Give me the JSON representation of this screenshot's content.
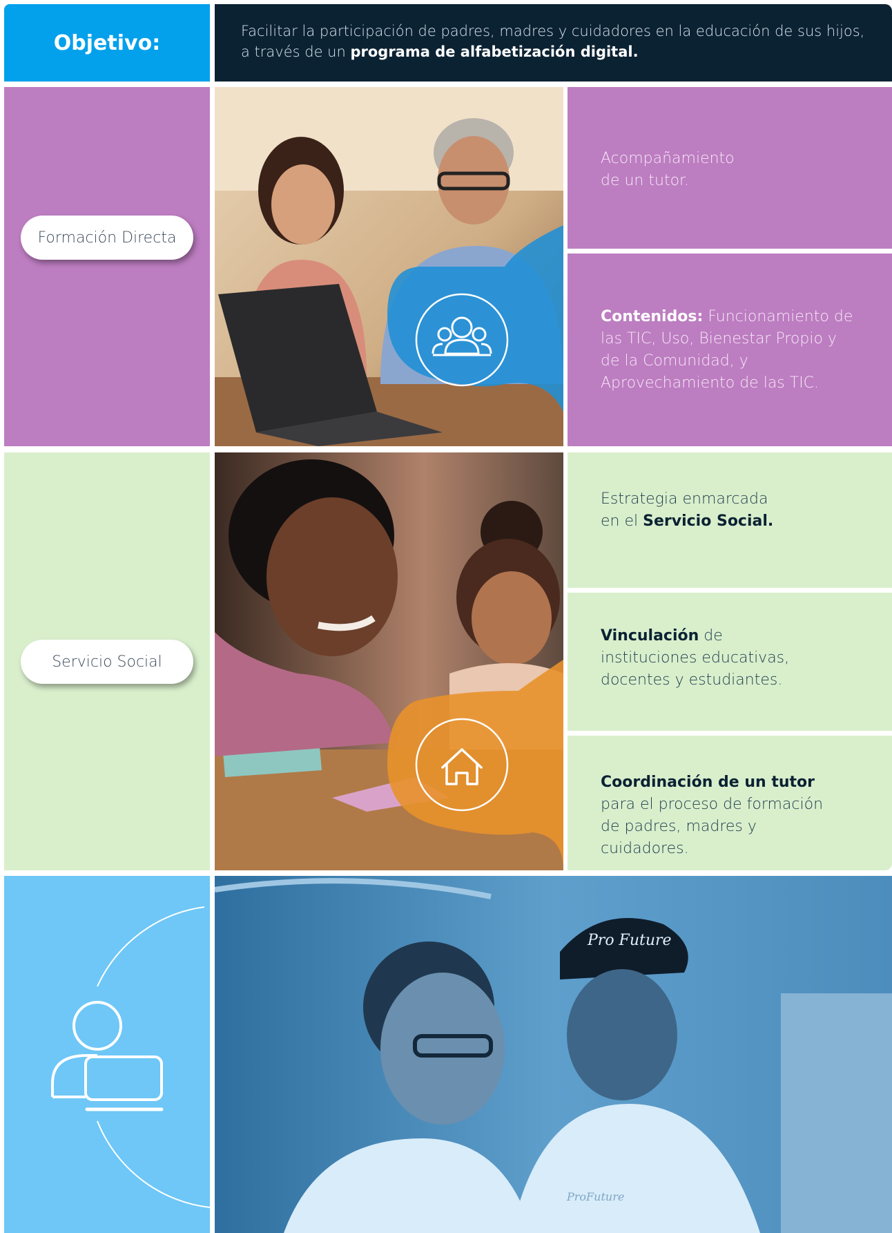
{
  "objective": {
    "label": "Objetivo:",
    "text_plain": "Facilitar la participación de padres, madres y cuidadores en la educación de sus hijos, a través de un ",
    "text_bold": "programa de alfabetización digital."
  },
  "formacion_directa": {
    "pill_label": "Formación Directa",
    "card1_text": "Acompañamiento de un tutor.",
    "card2_bold": "Contenidos:",
    "card2_text": " Funcionamiento de las TIC, Uso, Bienestar Propio y de la Comunidad, y Aprovechamiento de las TIC.",
    "icon": "people-group-icon"
  },
  "servicio_social": {
    "pill_label": "Servicio Social",
    "card1_plain": "Estrategia enmarcada en el ",
    "card1_bold": "Servicio Social.",
    "card2_bold": "Vinculación",
    "card2_plain": " de instituciones educativas, docentes y estudiantes.",
    "card3_bold": "Coordinación de un tutor",
    "card3_plain": " para el proceso de formación de padres, madres y cuidadores.",
    "icon": "house-icon"
  },
  "tutor_section": {
    "icon": "person-computer-icon",
    "photo_cap_text": "Pro Future",
    "photo_shirt_text": "ProFuture"
  },
  "colors": {
    "objective_blue": "#03a0ec",
    "navy": "#0b2233",
    "purple": "#bd7dc1",
    "green": "#d9efcc",
    "sky": "#6ec7f6",
    "orange": "#e8912b",
    "overlay_blue": "#1f8fd6"
  }
}
